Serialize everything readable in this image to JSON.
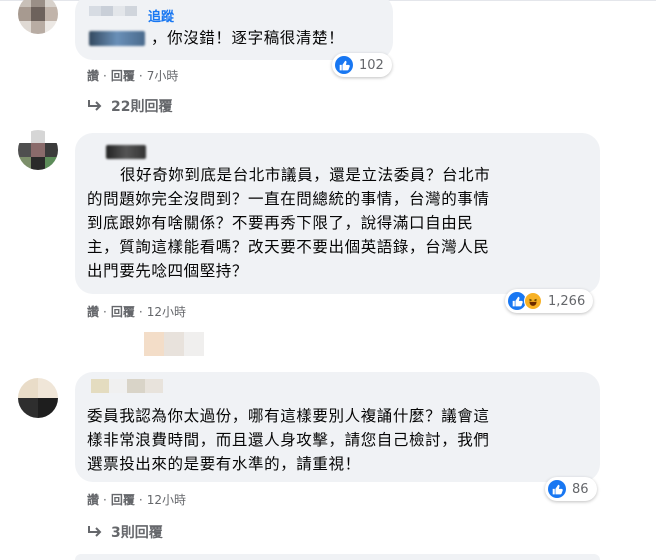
{
  "comments": [
    {
      "name": "追蹤",
      "text": "，你沒錯！逐字稿很清楚！",
      "reaction_count": "102",
      "actions": [
        "讚",
        "回覆"
      ],
      "time": "7小時",
      "replies": "22則回覆"
    },
    {
      "text_lines": [
        "很好奇妳到底是台北市議員，還是立法委員？台北市",
        "的問題妳完全沒問到？一直在問總統的事情，台灣的事情",
        "到底跟妳有啥關係？不要再秀下限了，說得滿口自由民",
        "主，質詢這樣能看嗎？改天要不要出個英語錄，台灣人民",
        "出門要先唸四個堅持？"
      ],
      "reaction_count": "1,266",
      "actions": [
        "讚",
        "回覆"
      ],
      "time": "12小時"
    },
    {
      "text_lines": [
        "委員我認為你太過份，哪有這樣要別人複誦什麼？議會這",
        "樣非常浪費時間，而且還人身攻擊，請您自己檢討，我們",
        "選票投出來的是要有水準的，請重視！"
      ],
      "reaction_count": "86",
      "actions": [
        "讚",
        "回覆"
      ],
      "time": "12小時",
      "replies": "3則回覆"
    }
  ],
  "colors": {
    "bubble": "#f0f2f5",
    "link": "#1877f2",
    "meta": "#65676b",
    "like": "#1877f2",
    "haha": "#f7b125"
  },
  "icons": [
    "like-reaction-icon",
    "haha-reaction-icon",
    "reply-arrow-icon"
  ]
}
